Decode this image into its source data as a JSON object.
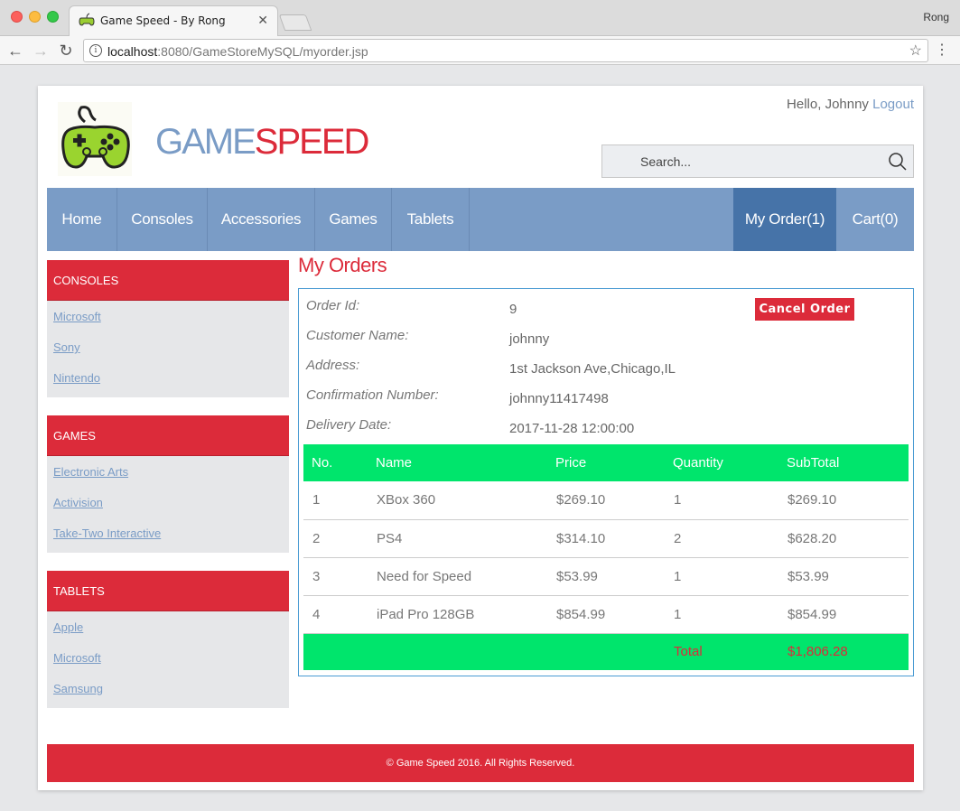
{
  "browser": {
    "tab_title": "Game Speed - By Rong",
    "tab_close": "✕",
    "profile": "Rong",
    "url_host": "localhost",
    "url_rest": ":8080/GameStoreMySQL/myorder.jsp"
  },
  "header": {
    "brand_part1": "GAME",
    "brand_part2": "SPEED",
    "greeting": "Hello, Johnny",
    "logout": "Logout",
    "search_placeholder": "Search..."
  },
  "nav": {
    "items": [
      "Home",
      "Consoles",
      "Accessories",
      "Games",
      "Tablets"
    ],
    "my_order": "My Order(1)",
    "cart": "Cart(0)"
  },
  "sidebar": {
    "consoles": {
      "title": "CONSOLES",
      "links": [
        "Microsoft",
        "Sony",
        "Nintendo"
      ]
    },
    "games": {
      "title": "GAMES",
      "links": [
        "Electronic Arts",
        "Activision",
        "Take-Two Interactive"
      ]
    },
    "tablets": {
      "title": "TABLETS",
      "links": [
        "Apple",
        "Microsoft",
        "Samsung"
      ]
    }
  },
  "main": {
    "title": "My Orders",
    "cancel_label": "Cancel Order",
    "info": {
      "order_id_label": "Order Id:",
      "order_id": "9",
      "customer_label": "Customer Name:",
      "customer": "johnny",
      "address_label": "Address:",
      "address": "1st Jackson Ave,Chicago,IL",
      "confirmation_label": "Confirmation Number:",
      "confirmation": "johnny11417498",
      "delivery_label": "Delivery Date:",
      "delivery": "2017-11-28 12:00:00"
    },
    "table": {
      "headers": [
        "No.",
        "Name",
        "Price",
        "Quantity",
        "SubTotal"
      ],
      "rows": [
        [
          "1",
          "XBox 360",
          "$269.10",
          "1",
          "$269.10"
        ],
        [
          "2",
          "PS4",
          "$314.10",
          "2",
          "$628.20"
        ],
        [
          "3",
          "Need for Speed",
          "$53.99",
          "1",
          "$53.99"
        ],
        [
          "4",
          "iPad Pro 128GB",
          "$854.99",
          "1",
          "$854.99"
        ]
      ],
      "total_label": "Total",
      "total_value": "$1,806.28"
    }
  },
  "footer": {
    "text": "© Game Speed 2016. All Rights Reserved."
  }
}
